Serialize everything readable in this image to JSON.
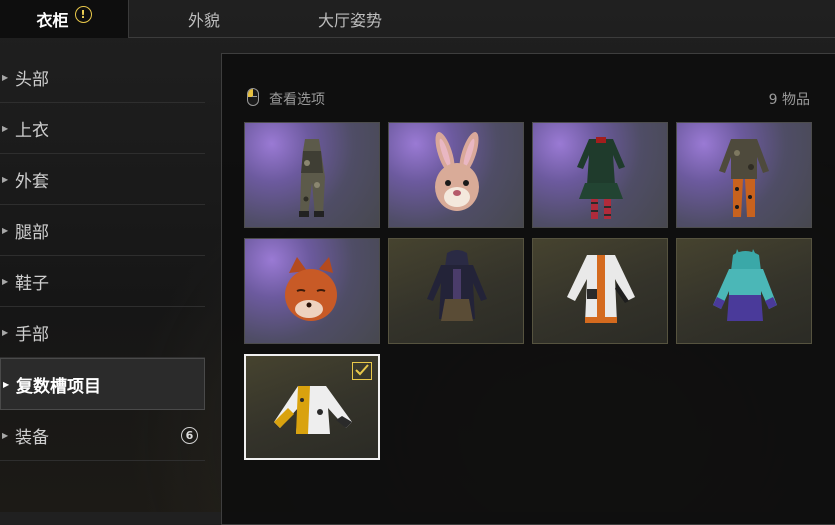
{
  "tabs": [
    {
      "label": "衣柜",
      "active": true,
      "alert": "!"
    },
    {
      "label": "外貌",
      "active": false
    },
    {
      "label": "大厅姿势",
      "active": false
    }
  ],
  "sidebar": {
    "items": [
      {
        "label": "头部"
      },
      {
        "label": "上衣"
      },
      {
        "label": "外套"
      },
      {
        "label": "腿部"
      },
      {
        "label": "鞋子"
      },
      {
        "label": "手部"
      },
      {
        "label": "复数槽项目",
        "active": true
      },
      {
        "label": "装备",
        "badge": "6"
      }
    ]
  },
  "panel": {
    "options_label": "查看选项",
    "item_count": "9 物品",
    "items": [
      {
        "name": "camo-overalls",
        "bg": "purple"
      },
      {
        "name": "bunny-mask",
        "bg": "purple"
      },
      {
        "name": "green-dress",
        "bg": "purple"
      },
      {
        "name": "camo-jacket-orange-pants",
        "bg": "purple"
      },
      {
        "name": "fox-mask",
        "bg": "purple"
      },
      {
        "name": "hooded-dark-outfit",
        "bg": "olive"
      },
      {
        "name": "white-orange-jacket",
        "bg": "olive"
      },
      {
        "name": "teal-purple-hoodie",
        "bg": "olive"
      },
      {
        "name": "yellow-white-jacket",
        "bg": "olive",
        "selected": true
      }
    ]
  },
  "colors": {
    "accent": "#e9c84a",
    "selected_border": "#f0f0f0",
    "panel_bg": "#0e0e0e"
  }
}
